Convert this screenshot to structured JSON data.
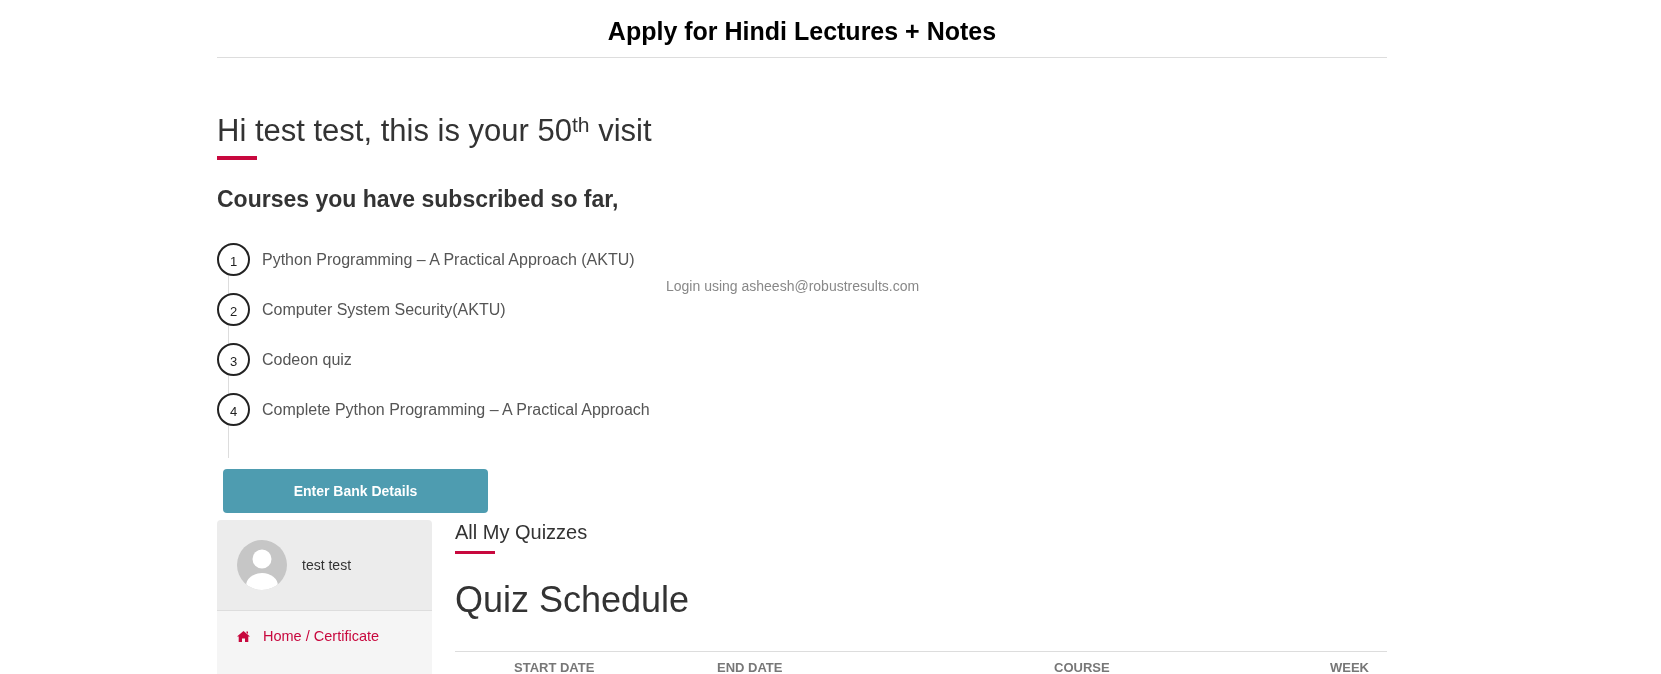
{
  "header": {
    "title": "Apply for Hindi Lectures + Notes"
  },
  "welcome": {
    "greeting": "Hi test test, this is your 50$^{th}$ visit",
    "courses_heading": "Courses you have subscribed so far,",
    "courses": [
      {
        "number": "1",
        "title": "Python Programming – A Practical Approach (AKTU)"
      },
      {
        "number": "2",
        "title": "Computer System Security(AKTU)"
      },
      {
        "number": "3",
        "title": "Codeon quiz"
      },
      {
        "number": "4",
        "title": "Complete Python Programming – A Practical Approach"
      }
    ],
    "login_note": "Login using asheesh@robustresults.com",
    "bank_button": "Enter Bank Details"
  },
  "sidebar": {
    "user_name": "test test",
    "menu": [
      {
        "label": "Home / Certificate"
      }
    ]
  },
  "quizzes": {
    "section_title": "All My Quizzes",
    "heading": "Quiz Schedule",
    "table": {
      "columns": [
        "START DATE",
        "END DATE",
        "COURSE",
        "WEEK"
      ]
    }
  }
}
